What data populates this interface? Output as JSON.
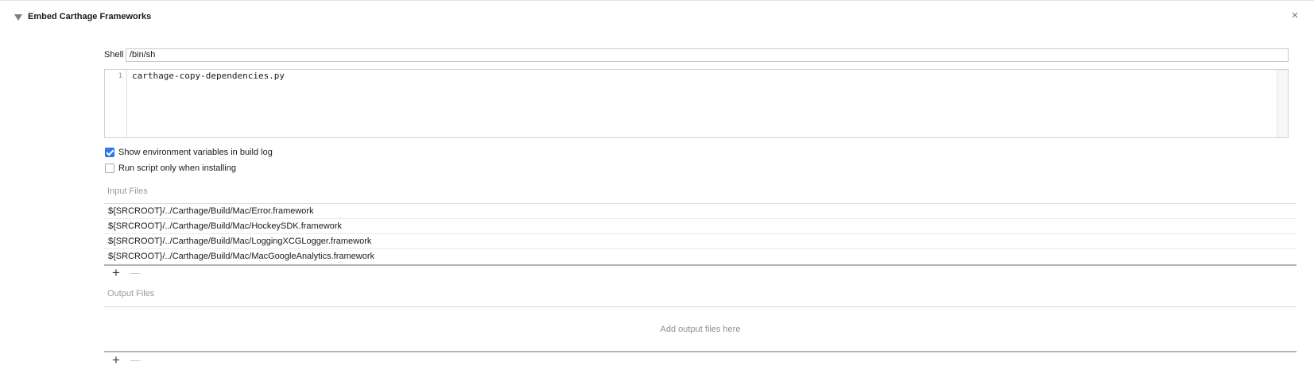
{
  "phase": {
    "title": "Embed Carthage Frameworks",
    "close_glyph": "×"
  },
  "shell": {
    "label": "Shell",
    "value": "/bin/sh"
  },
  "script": {
    "line_numbers": [
      "1"
    ],
    "lines": [
      "carthage-copy-dependencies.py"
    ]
  },
  "options": [
    {
      "label": "Show environment variables in build log",
      "checked": true
    },
    {
      "label": "Run script only when installing",
      "checked": false
    }
  ],
  "input_files": {
    "label": "Input Files",
    "items": [
      "${SRCROOT}/../Carthage/Build/Mac/Error.framework",
      "${SRCROOT}/../Carthage/Build/Mac/HockeySDK.framework",
      "${SRCROOT}/../Carthage/Build/Mac/LoggingXCGLogger.framework",
      "${SRCROOT}/../Carthage/Build/Mac/MacGoogleAnalytics.framework"
    ]
  },
  "output_files": {
    "label": "Output Files",
    "placeholder": "Add output files here"
  },
  "controls": {
    "add_glyph": "+",
    "remove_glyph": "—"
  },
  "icons": {
    "disclosure": "disclosure-triangle-down-icon",
    "close": "close-icon",
    "add": "plus-icon",
    "remove": "minus-icon"
  },
  "colors": {
    "checkbox_accent": "#2e7bf6",
    "secondary_text": "#9b9b9b"
  }
}
